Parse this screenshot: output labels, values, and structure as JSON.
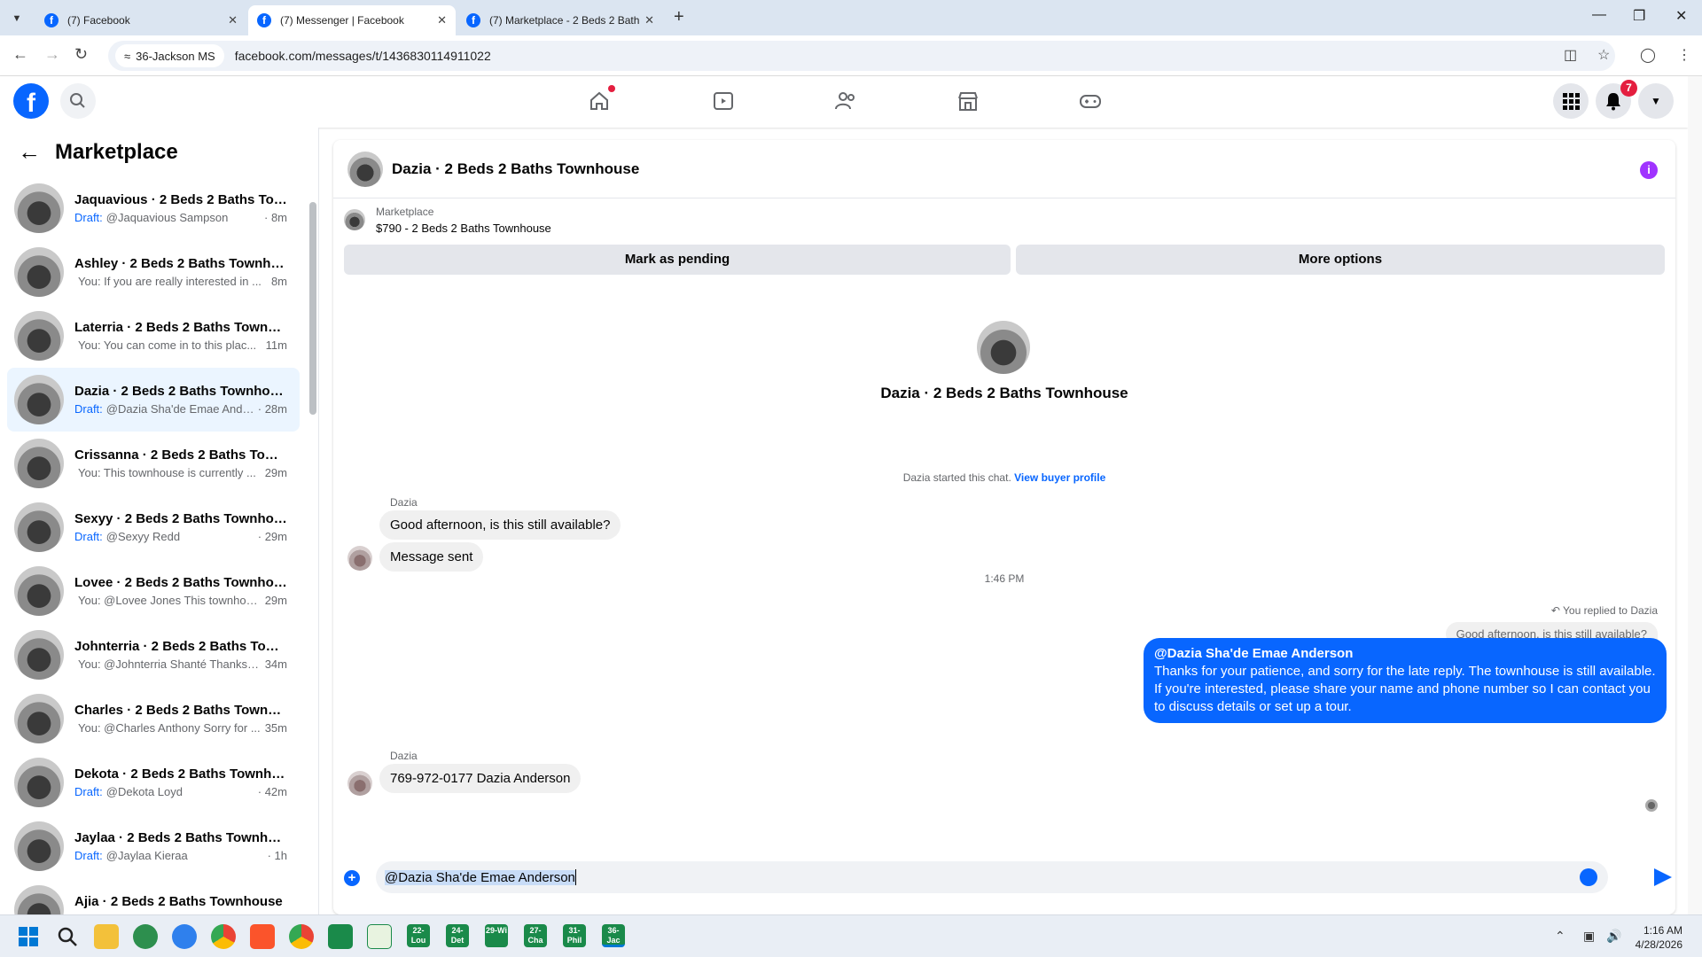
{
  "browser": {
    "tabs": [
      {
        "title": "(7) Facebook"
      },
      {
        "title": "(7) Messenger | Facebook"
      },
      {
        "title": "(7) Marketplace - 2 Beds 2 Bath"
      }
    ],
    "site_chip": "36-Jackson MS",
    "url": "facebook.com/messages/t/1436830114911022"
  },
  "header": {
    "notification_count": "7"
  },
  "sidebar": {
    "title": "Marketplace",
    "conversations": [
      {
        "name": "Jaquavious · 2 Beds 2 Baths Tow...",
        "draft": "Draft:",
        "preview": "@Jaquavious Sampson",
        "time": "· 8m"
      },
      {
        "name": "Ashley · 2 Beds 2 Baths Townho...",
        "draft": "",
        "preview": "You: If you are really interested in ...",
        "time": "8m"
      },
      {
        "name": "Laterria · 2 Beds 2 Baths Townho...",
        "draft": "",
        "preview": "You: You can come in to this plac...",
        "time": "11m"
      },
      {
        "name": "Dazia · 2 Beds 2 Baths Townhouse",
        "draft": "Draft:",
        "preview": "@Dazia Sha'de Emae Ande...",
        "time": "· 28m"
      },
      {
        "name": "Crissanna · 2 Beds 2 Baths Town...",
        "draft": "",
        "preview": "You: This townhouse is currently ...",
        "time": "29m"
      },
      {
        "name": "Sexyy · 2 Beds 2 Baths Townhouse",
        "draft": "Draft:",
        "preview": "@Sexyy Redd",
        "time": "· 29m"
      },
      {
        "name": "Lovee · 2 Beds 2 Baths Townhouse",
        "draft": "",
        "preview": "You: @Lovee Jones This townhou...",
        "time": "29m"
      },
      {
        "name": "Johnterria · 2 Beds 2 Baths Town...",
        "draft": "",
        "preview": "You: @Johnterria Shanté Thanks f...",
        "time": "34m"
      },
      {
        "name": "Charles · 2 Beds 2 Baths Townho...",
        "draft": "",
        "preview": "You: @Charles Anthony Sorry for ...",
        "time": "35m"
      },
      {
        "name": "Dekota · 2 Beds 2 Baths Townho...",
        "draft": "Draft:",
        "preview": "@Dekota Loyd",
        "time": "· 42m"
      },
      {
        "name": "Jaylaa · 2 Beds 2 Baths Townhouse",
        "draft": "Draft:",
        "preview": "@Jaylaa Kieraa",
        "time": "· 1h"
      },
      {
        "name": "Ajia · 2 Beds 2 Baths Townhouse",
        "draft": "",
        "preview": "You: @Ajia Grant Thanks for yo...",
        "time": "1h"
      }
    ]
  },
  "chat": {
    "title": "Dazia · 2 Beds 2 Baths Townhouse",
    "listing_source": "Marketplace",
    "listing_price": "$790 - 2 Beds 2 Baths Townhouse",
    "mark_pending": "Mark as pending",
    "more_options": "More options",
    "center_name": "Dazia · 2 Beds 2 Baths Townhouse",
    "started_text": "Dazia started this chat.",
    "view_profile": "View buyer profile",
    "sender_label": "Dazia",
    "msg1": "Good afternoon, is this still available?",
    "msg2": "Message sent",
    "timestamp": "1:46 PM",
    "replied_label": "You replied to Dazia",
    "quoted": "Good afternoon, is this still available?",
    "my_mention": "@Dazia Sha'de Emae Anderson",
    "my_text": "Thanks for your patience, and sorry for the late reply. The townhouse is still available. If you're interested, please share your name and phone number so I can contact you to discuss details or set up a tour.",
    "sender_label2": "Dazia",
    "msg3": "769-972-0177 Dazia Anderson",
    "composer_text": "@Dazia Sha'de Emae Anderson"
  },
  "taskbar": {
    "apps": [
      "22-Lou",
      "24-Det",
      "29-Wi",
      "27-Cha",
      "31-Phil",
      "36-Jac"
    ],
    "time": "1:16 AM",
    "date": "4/28/2026"
  },
  "colors": {
    "brand": "#0866ff",
    "badge": "#e41e3f"
  }
}
